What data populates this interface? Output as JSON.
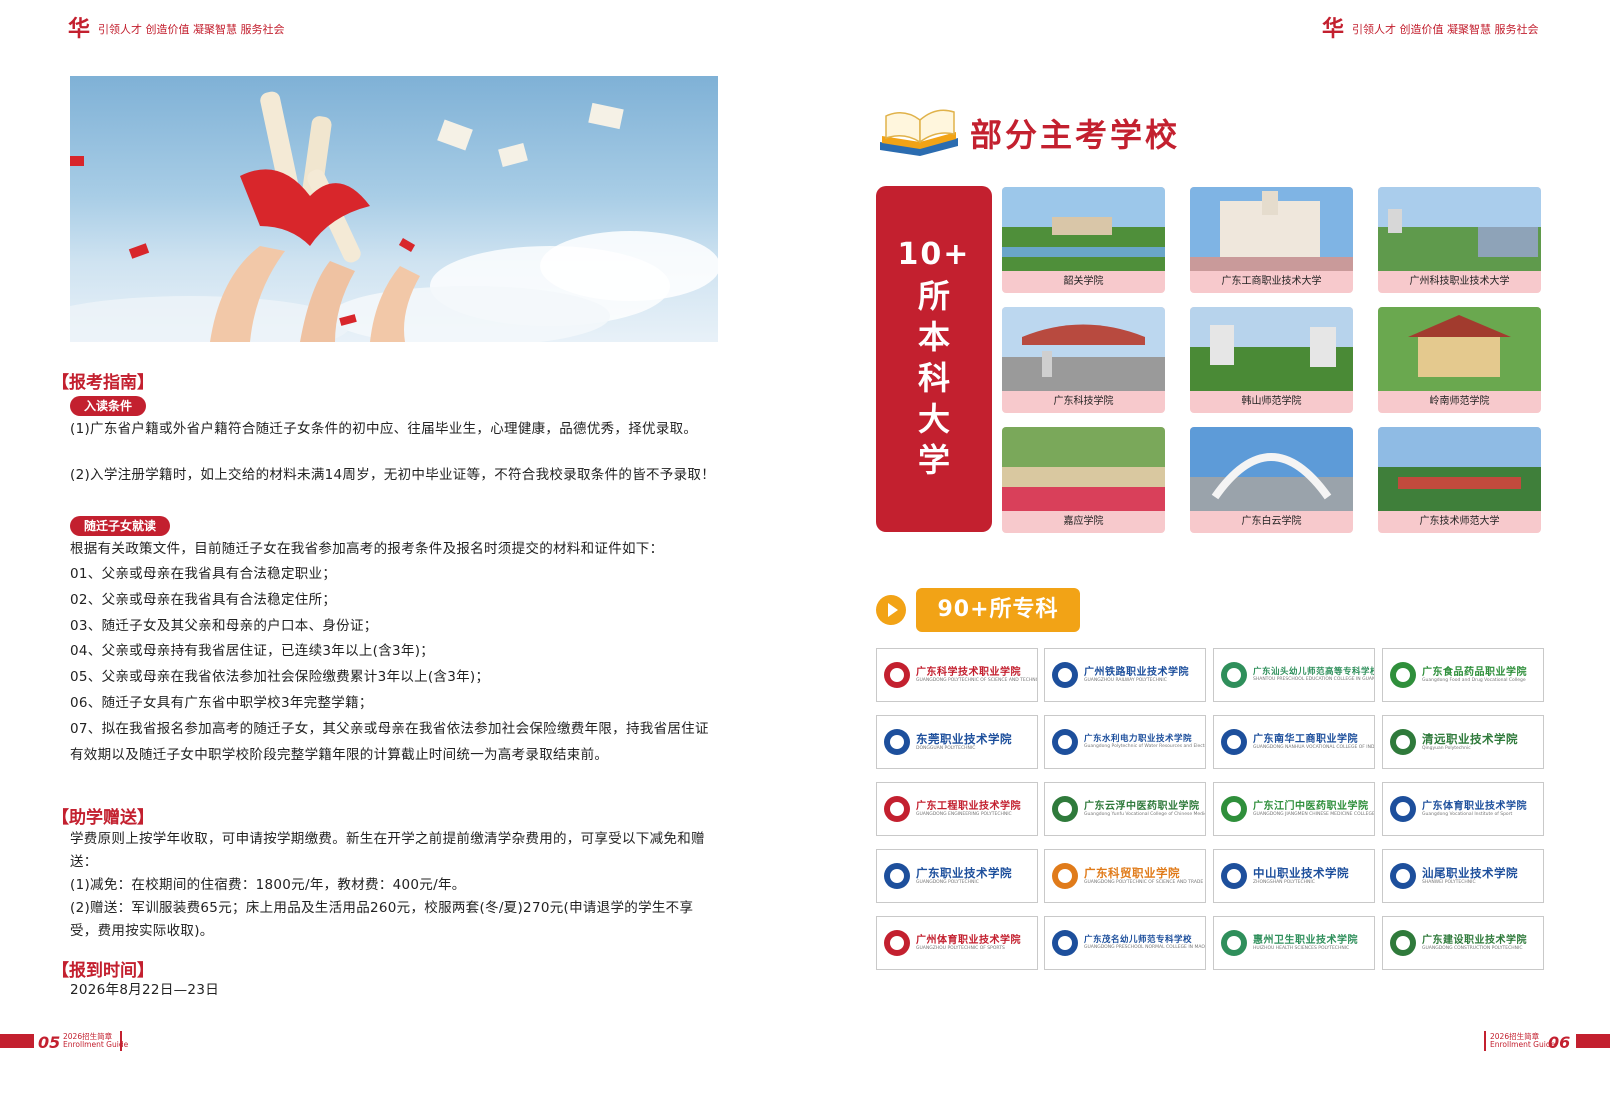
{
  "header": {
    "logo_glyph": "华",
    "slogan": "引领人才 创造价值 凝聚智慧 服务社会"
  },
  "left": {
    "guide_title": "【报考指南】",
    "entry_pill": "入读条件",
    "entry_1": "(1)广东省户籍或外省户籍符合随迁子女条件的初中应、往届毕业生，心理健康，品德优秀，择优录取。",
    "entry_2": "(2)入学注册学籍时，如上交给的材料未满14周岁，无初中毕业证等，不符合我校录取条件的皆不予录取！",
    "migrant_pill": "随迁子女就读",
    "migrant_intro": "根据有关政策文件，目前随迁子女在我省参加高考的报考条件及报名时须提交的材料和证件如下：",
    "migrant_items": [
      "01、父亲或母亲在我省具有合法稳定职业；",
      "02、父亲或母亲在我省具有合法稳定住所；",
      "03、随迁子女及其父亲和母亲的户口本、身份证；",
      "04、父亲或母亲持有我省居住证，已连续3年以上(含3年)；",
      "05、父亲或母亲在我省依法参加社会保险缴费累计3年以上(含3年)；",
      "06、随迁子女具有广东省中职学校3年完整学籍；",
      "07、拟在我省报名参加高考的随迁子女，其父亲或母亲在我省依法参加社会保险缴费年限，持我省居住证有效期以及随迁子女中职学校阶段完整学籍年限的计算截止时间统一为高考录取结束前。"
    ],
    "aid_title": "【助学赠送】",
    "aid_intro": "学费原则上按学年收取，可申请按学期缴费。新生在开学之前提前缴清学杂费用的，可享受以下减免和赠送：",
    "aid_1": "(1)减免：在校期间的住宿费：1800元/年，教材费：400元/年。",
    "aid_2": "(2)赠送：军训服装费65元；床上用品及生活用品260元，校服两套(冬/夏)270元(申请退学的学生不享受，费用按实际收取)。",
    "report_title": "【报到时间】",
    "report_date": "2026年8月22日—23日"
  },
  "footer": {
    "left_num": "05",
    "right_num": "06",
    "guide_cn": "2026招生简章",
    "guide_en": "Enrollment Guide"
  },
  "right": {
    "title": "部分主考学校",
    "bachelor_num": "10+",
    "bachelor_chars": [
      "所",
      "本",
      "科",
      "大",
      "学"
    ],
    "universities": [
      "韶关学院",
      "广东工商职业技术大学",
      "广州科技职业技术大学",
      "广东科技学院",
      "韩山师范学院",
      "岭南师范学院",
      "嘉应学院",
      "广东白云学院",
      "广东技术师范大学"
    ],
    "college_label": "90+所专科",
    "colleges": [
      {
        "cn": "广东科学技术职业学院",
        "en": "GUANGDONG POLYTECHNIC OF SCIENCE AND TECHNOLOGY",
        "color": "#c3202f"
      },
      {
        "cn": "广州铁路职业技术学院",
        "en": "GUANGZHOU RAILWAY POLYTECHNIC",
        "color": "#1d4f9c"
      },
      {
        "cn": "广东汕头幼儿师范高等专科学校",
        "en": "SHANTOU PRESCHOOL EDUCATION COLLEGE IN GUANGDONG",
        "color": "#2f8f5b"
      },
      {
        "cn": "广东食品药品职业学院",
        "en": "Guangdong Food and Drug Vocational College",
        "color": "#2f8f3b"
      },
      {
        "cn": "东莞职业技术学院",
        "en": "DONGGUAN POLYTECHNIC",
        "color": "#1d4f9c"
      },
      {
        "cn": "广东水利电力职业技术学院",
        "en": "Guangdong Polytechnic of Water Resources and Electric Engineering",
        "color": "#1d4f9c"
      },
      {
        "cn": "广东南华工商职业学院",
        "en": "GUANGDONG NANHUA VOCATIONAL COLLEGE OF INDUSTRY AND COMMERCE",
        "color": "#1d4f9c"
      },
      {
        "cn": "清远职业技术学院",
        "en": "Qingyuan Polytechnic",
        "color": "#2f7a3b"
      },
      {
        "cn": "广东工程职业技术学院",
        "en": "GUANGDONG ENGINEERING POLYTECHNIC",
        "color": "#c3202f"
      },
      {
        "cn": "广东云浮中医药职业学院",
        "en": "Guangdong Yunfu Vocational College of Chinese Medicine",
        "color": "#2f7a3b"
      },
      {
        "cn": "广东江门中医药职业学院",
        "en": "GUANGDONG JIANGMEN CHINESE MEDICINE COLLEGE",
        "color": "#2f8f3b"
      },
      {
        "cn": "广东体育职业技术学院",
        "en": "Guangdong Vocational Institute of Sport",
        "color": "#1d4f9c"
      },
      {
        "cn": "广东职业技术学院",
        "en": "GUANGDONG POLYTECHNIC",
        "color": "#1d4f9c"
      },
      {
        "cn": "广东科贸职业学院",
        "en": "GUANGDONG POLYTECHNIC OF SCIENCE AND TRADE",
        "color": "#e07b1a"
      },
      {
        "cn": "中山职业技术学院",
        "en": "ZHONGSHAN POLYTECHNIC",
        "color": "#1d4f9c"
      },
      {
        "cn": "汕尾职业技术学院",
        "en": "SHANWEI POLYTECHNIC",
        "color": "#1d4f9c"
      },
      {
        "cn": "广州体育职业技术学院",
        "en": "GUANGZHOU POLYTECHNIC OF SPORTS",
        "color": "#c3202f"
      },
      {
        "cn": "广东茂名幼儿师范专科学校",
        "en": "GUANGDONG PRESCHOOL NORMAL COLLEGE IN MAOMING",
        "color": "#1d4f9c"
      },
      {
        "cn": "惠州卫生职业技术学院",
        "en": "HUIZHOU HEALTH SCIENCES POLYTECHNIC",
        "color": "#2f8f5b"
      },
      {
        "cn": "广东建设职业技术学院",
        "en": "GUANGDONG CONSTRUCTION POLYTECHNIC",
        "color": "#2f7a3b"
      }
    ]
  },
  "colors": {
    "brand_red": "#c3202f",
    "accent_orange": "#f2a316",
    "caption_pink": "#f7c9cc"
  }
}
